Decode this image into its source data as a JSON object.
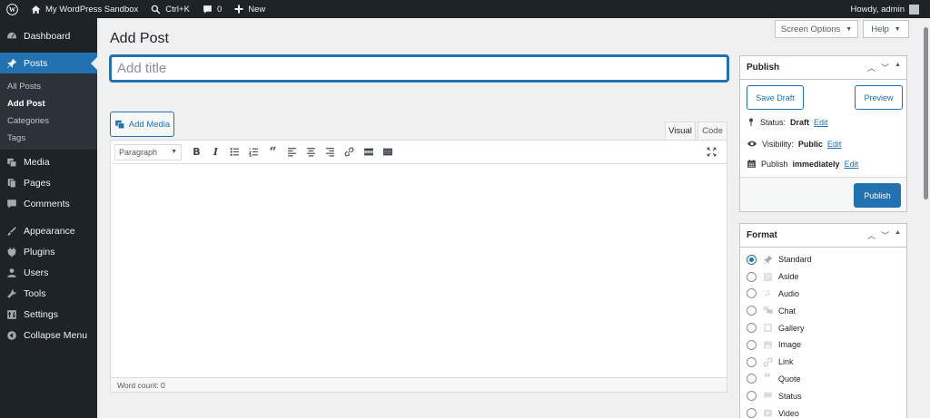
{
  "adminbar": {
    "site_name": "My WordPress Sandbox",
    "search_shortcut": "Ctrl+K",
    "comments_count": "0",
    "new_label": "New",
    "howdy": "Howdy, admin"
  },
  "sidebar": {
    "items": [
      {
        "label": "Dashboard",
        "icon": "dashboard-icon"
      },
      {
        "label": "Posts",
        "icon": "pin-icon"
      },
      {
        "label": "Media",
        "icon": "media-icon"
      },
      {
        "label": "Pages",
        "icon": "pages-icon"
      },
      {
        "label": "Comments",
        "icon": "comments-icon"
      },
      {
        "label": "Appearance",
        "icon": "brush-icon"
      },
      {
        "label": "Plugins",
        "icon": "plugin-icon"
      },
      {
        "label": "Users",
        "icon": "users-icon"
      },
      {
        "label": "Tools",
        "icon": "wrench-icon"
      },
      {
        "label": "Settings",
        "icon": "settings-icon"
      },
      {
        "label": "Collapse Menu",
        "icon": "collapse-icon"
      }
    ],
    "submenu": [
      "All Posts",
      "Add Post",
      "Categories",
      "Tags"
    ]
  },
  "screen": {
    "screen_options": "Screen Options",
    "help": "Help"
  },
  "page": {
    "title": "Add Post",
    "title_placeholder": "Add title",
    "add_media": "Add Media",
    "tab_visual": "Visual",
    "tab_code": "Code",
    "format_select": "Paragraph",
    "word_count": "Word count: 0"
  },
  "publish": {
    "header": "Publish",
    "save_draft": "Save Draft",
    "preview": "Preview",
    "status_label": "Status:",
    "status_value": "Draft",
    "visibility_label": "Visibility:",
    "visibility_value": "Public",
    "publish_label": "Publish",
    "publish_value": "immediately",
    "edit": "Edit",
    "publish_button": "Publish"
  },
  "format": {
    "header": "Format",
    "options": [
      "Standard",
      "Aside",
      "Audio",
      "Chat",
      "Gallery",
      "Image",
      "Link",
      "Quote",
      "Status",
      "Video"
    ],
    "selected": "Standard"
  },
  "colors": {
    "accent": "#2271b1",
    "admin_dark": "#1d2327",
    "background": "#f0f0f1"
  }
}
